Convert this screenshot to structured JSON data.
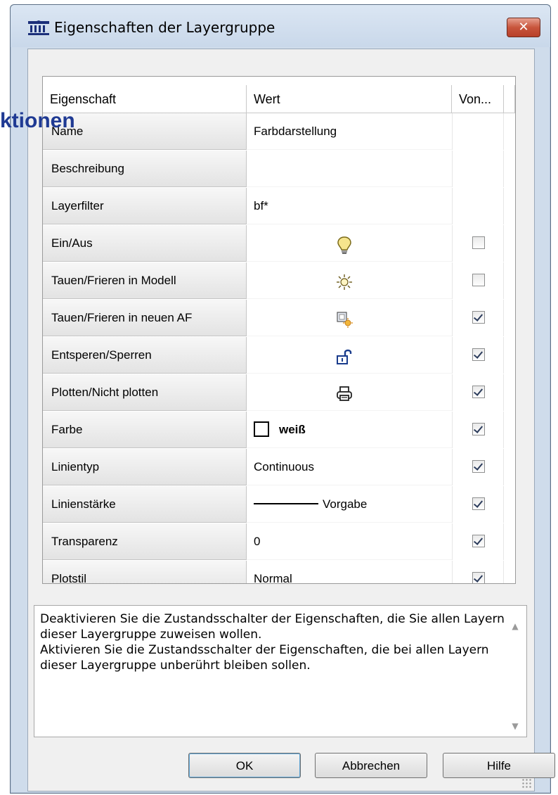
{
  "background_overlay_text": "ktionen",
  "window": {
    "title": "Eigenschaften der Layergruppe",
    "title_icon": "building-columns-icon",
    "close_label": "✕"
  },
  "grid": {
    "columns": [
      "Eigenschaft",
      "Wert",
      "Von..."
    ],
    "rows": [
      {
        "name": "Name",
        "value": "Farbdarstellung",
        "value_type": "text",
        "has_checkbox": false
      },
      {
        "name": "Beschreibung",
        "value": "",
        "value_type": "text",
        "has_checkbox": false
      },
      {
        "name": "Layerfilter",
        "value": "bf*",
        "value_type": "text",
        "has_checkbox": false
      },
      {
        "name": "Ein/Aus",
        "value": "",
        "value_type": "icon",
        "icon": "lightbulb-icon",
        "has_checkbox": true,
        "checked": false
      },
      {
        "name": "Tauen/Frieren in Modell",
        "value": "",
        "value_type": "icon",
        "icon": "sun-icon",
        "has_checkbox": true,
        "checked": false
      },
      {
        "name": "Tauen/Frieren in neuen AF",
        "value": "",
        "value_type": "icon",
        "icon": "viewport-sun-icon",
        "has_checkbox": true,
        "checked": true
      },
      {
        "name": "Entsperen/Sperren",
        "value": "",
        "value_type": "icon",
        "icon": "unlocked-padlock-icon",
        "has_checkbox": true,
        "checked": true
      },
      {
        "name": "Plotten/Nicht plotten",
        "value": "",
        "value_type": "icon",
        "icon": "printer-icon",
        "has_checkbox": true,
        "checked": true
      },
      {
        "name": "Farbe",
        "value": "weiß",
        "value_type": "color",
        "swatch_color": "#ffffff",
        "has_checkbox": true,
        "checked": true
      },
      {
        "name": "Linientyp",
        "value": "Continuous",
        "value_type": "text",
        "has_checkbox": true,
        "checked": true
      },
      {
        "name": "Linienstärke",
        "value": "Vorgabe",
        "value_type": "lineweight",
        "has_checkbox": true,
        "checked": true
      },
      {
        "name": "Transparenz",
        "value": "0",
        "value_type": "text",
        "has_checkbox": true,
        "checked": true
      },
      {
        "name": "Plotstil",
        "value": "Normal",
        "value_type": "text",
        "has_checkbox": true,
        "checked": true
      }
    ]
  },
  "description": {
    "lines": [
      "Deaktivieren Sie die Zustandsschalter der Eigenschaften, die Sie allen Layern",
      "dieser Layergruppe zuweisen wollen.",
      "Aktivieren Sie die Zustandsschalter der Eigenschaften, die bei allen Layern",
      "dieser Layergruppe unberührt bleiben sollen."
    ]
  },
  "buttons": {
    "ok": "OK",
    "cancel": "Abbrechen",
    "help": "Hilfe"
  },
  "colors": {
    "title_bg": "#cfdceb",
    "close_button": "#c8553c",
    "overlay_text": "#1f3a93"
  }
}
